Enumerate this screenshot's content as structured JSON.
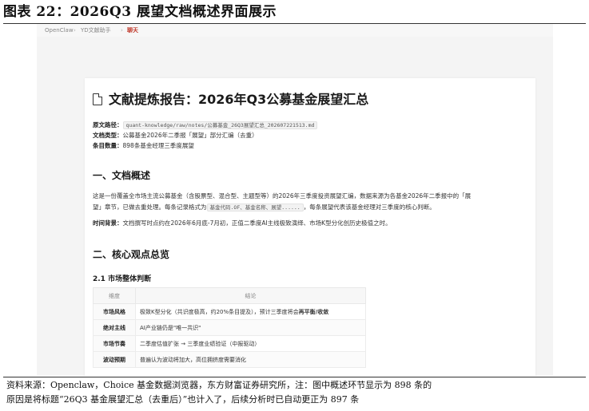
{
  "figure_title": "图表 22：2026Q3 展望文档概述界面展示",
  "breadcrumb": {
    "items": [
      "OpenClaw",
      "YD文献助手",
      "聊天"
    ],
    "separator": "›"
  },
  "document": {
    "title": "文献提炼报告：2026年Q3公募基金展望汇总",
    "meta": [
      {
        "label": "原文路径：",
        "value": "quant-knowledge/raw/notes/公募基金_26Q3展望汇总_202607221513.md"
      },
      {
        "label": "文档类型：",
        "value": "公募基金2026年二季报「展望」部分汇编（去重）"
      },
      {
        "label": "条目数量：",
        "value": "898条基金经理三季度展望"
      }
    ],
    "section1": {
      "heading": "一、文档概述",
      "para1_line1": "这是一份覆盖全市场主流公募基金（含股票型、混合型、主题型等）的2026年三季度投资展望汇编，数据来源为各基金2026年二季报中的「展",
      "para1_line2_pre": "望」章节，已做去重处理。每条记录格式为",
      "para1_code": "基金代码.OF、基金名称、展望......",
      "para1_line2_post": "，每条展望代表该基金经理对三季度的核心判断。",
      "para2_label": "时间背景：",
      "para2_text": "文档撰写时点约在2026年6月底-7月初，正值二季度AI主线极致演绎、市场K型分化创历史极值之时。"
    },
    "section2": {
      "heading": "二、核心观点总览",
      "subheading": "2.1 市场整体判断",
      "table": {
        "headers": [
          "维度",
          "结论"
        ],
        "rows": [
          {
            "dim": "市场风格",
            "pre": "极致K型分化（共识度极高，约20%条目提及），预计三季度将会",
            "bold": "再平衡/收敛",
            "post": ""
          },
          {
            "dim": "绝对主线",
            "pre": "AI产业链仍是\"唯一共识\"",
            "bold": "",
            "post": ""
          },
          {
            "dim": "市场节奏",
            "pre": "二季度估值扩张 → 三季度业绩验证（中报驱动）",
            "bold": "",
            "post": ""
          },
          {
            "dim": "波动预期",
            "pre": "普遍认为波动将加大，高位拥挤度需要消化",
            "bold": "",
            "post": ""
          }
        ]
      }
    }
  },
  "caption": {
    "line1": "资料来源：Openclaw，Choice 基金数据浏览器，东方财富证券研究所，注：图中概述环节显示为 898 条的",
    "line2": "原因是将标题“26Q3 基金展望汇总（去重后）”也计入了，后续分析时已自动更正为 897 条"
  }
}
